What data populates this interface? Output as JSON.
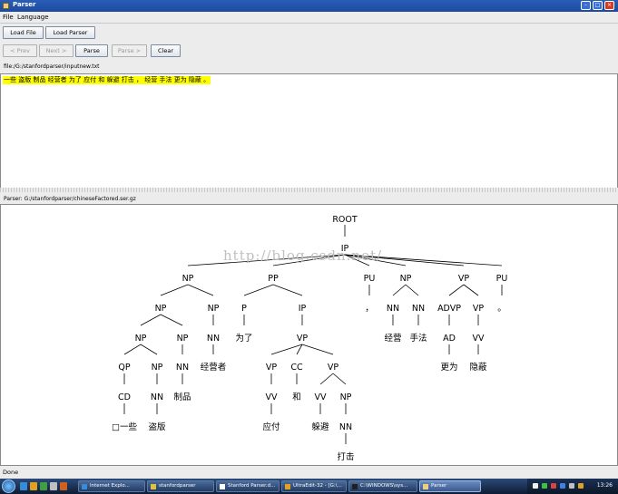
{
  "window": {
    "title": "Parser"
  },
  "menu": {
    "file": "File",
    "language": "Language"
  },
  "toolbar": {
    "load_file": "Load File",
    "load_parser": "Load Parser"
  },
  "nav": {
    "prev": "< Prev",
    "next": "Next >",
    "parse": "Parse",
    "parse_more": "Parse >",
    "clear": "Clear"
  },
  "file_label": "file:/G:/stanfordparser/inputnew.txt",
  "input_text": "一些 盗版 制品 经营者 为了 应付 和 躲避 打击 ， 经营 手法 更为 隐蔽 。",
  "parser_label": "Parser: G:/stanfordparser/chineseFactored.ser.gz",
  "watermark": "http://blog.csdn.net/",
  "status": "Done",
  "tree": {
    "root": "ROOT",
    "ip": "IP",
    "np1": "NP",
    "pp": "PP",
    "pu1": "PU",
    "np2": "NP",
    "vp1": "VP",
    "pu2": "PU",
    "np1a": "NP",
    "np1b": "NP",
    "p": "P",
    "ip2": "IP",
    "pu1w": "，",
    "nn_a": "NN",
    "nn_b": "NN",
    "advp": "ADVP",
    "vp2": "VP",
    "pu2w": "。",
    "np1a1": "NP",
    "np1a2": "NP",
    "np1b_nn": "NN",
    "p_w": "为了",
    "vp3": "VP",
    "jy1": "经营",
    "sf": "手法",
    "ad": "AD",
    "vv1": "VV",
    "qp": "QP",
    "np_c": "NP",
    "nn_c": "NN",
    "nn_c_w": "经营者",
    "vp4": "VP",
    "cc": "CC",
    "vp5": "VP",
    "gw": "更为",
    "yb": "隐蔽",
    "cd": "CD",
    "nn_d": "NN",
    "zp": "制品",
    "vv2": "VV",
    "he": "和",
    "vv3": "VV",
    "np_e": "NP",
    "cd_w": "□一些",
    "db": "盗版",
    "yf": "应付",
    "dbi": "躲避",
    "nn_e": "NN",
    "dj": "打击"
  },
  "taskbar": {
    "items": [
      "Internet Explo...",
      "stanfordparser",
      "Stanford Parser.d...",
      "UltraEdit-32 - [G:\\...",
      "C:\\WINDOWS\\sys...",
      "Parser"
    ],
    "clock": "13:26"
  }
}
